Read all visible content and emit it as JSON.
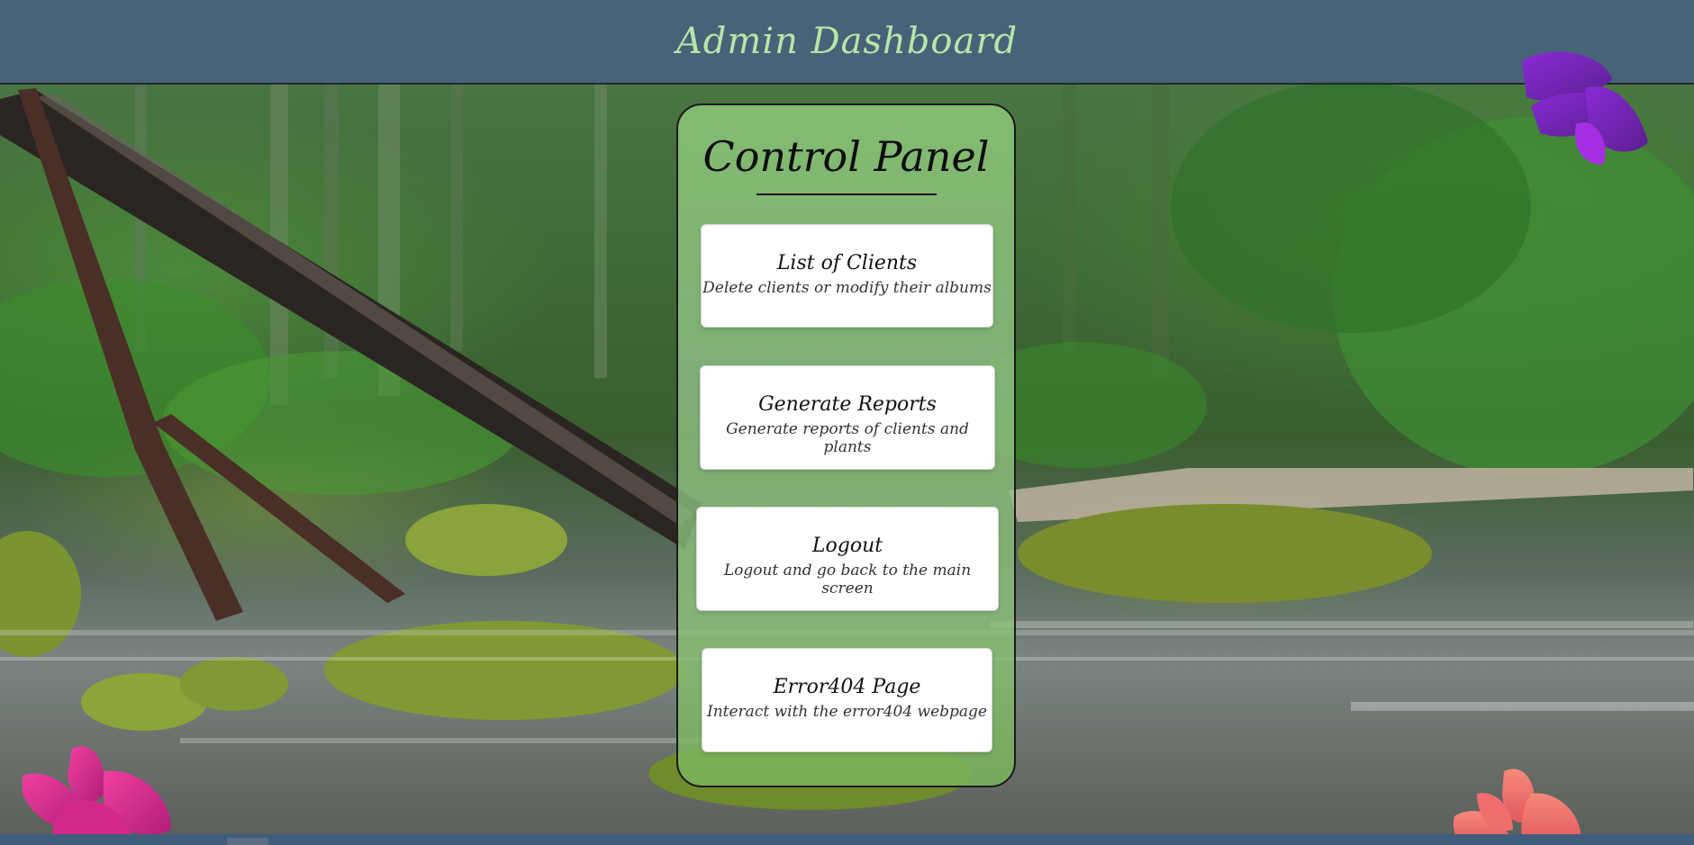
{
  "header": {
    "title": "Admin Dashboard"
  },
  "panel": {
    "title": "Control Panel",
    "cards": [
      {
        "title": "List of Clients",
        "description": "Delete clients or modify their albums"
      },
      {
        "title": "Generate Reports",
        "description": "Generate reports of clients and plants"
      },
      {
        "title": "Logout",
        "description": "Logout and go back to the main screen"
      },
      {
        "title": "Error404 Page",
        "description": "Interact with the error404 webpage"
      }
    ]
  },
  "decorations": {
    "flowers": [
      {
        "name": "purple-flower-icon",
        "color": "#9b2fd6"
      },
      {
        "name": "pink-flower-icon",
        "color": "#e0329a"
      },
      {
        "name": "coral-flower-icon",
        "color": "#f06a6a"
      }
    ]
  },
  "colors": {
    "header_bg": "#48607f",
    "header_title": "#b6e6a8",
    "panel_bg": "#8cc878",
    "card_bg": "#ffffff",
    "footer_bar": "#3f5d7c"
  }
}
